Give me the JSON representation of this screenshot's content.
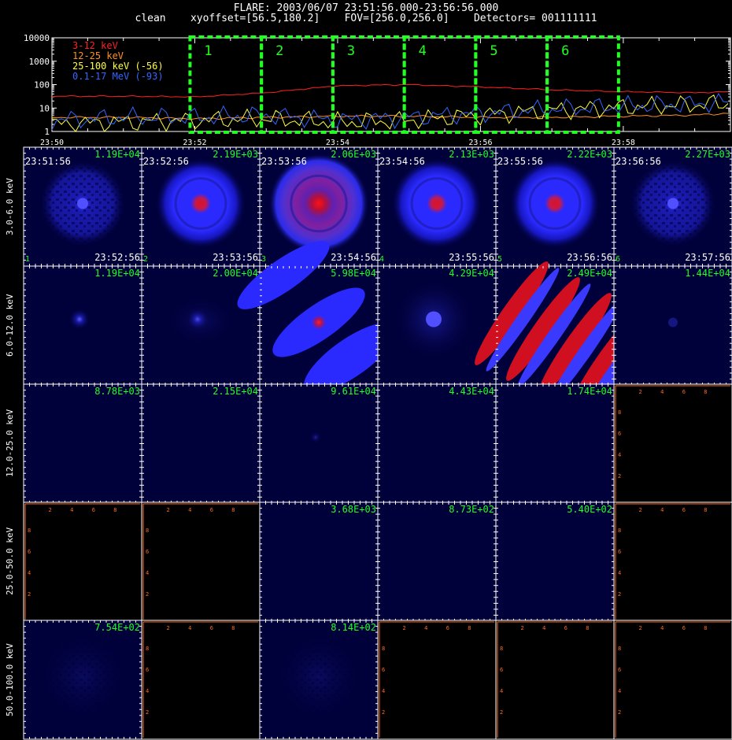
{
  "header": {
    "title": "FLARE: 2003/06/07 23:51:56.000-23:56:56.000",
    "subtitle": "clean    xyoffset=[56.5,180.2]    FOV=[256.0,256.0]    Detectors= 001111111"
  },
  "chart_data": [
    {
      "type": "line",
      "ylog": true,
      "ylim": [
        1,
        10000
      ],
      "ytick_labels": [
        "1",
        "10",
        "100",
        "1000",
        "10000"
      ],
      "xlim": [
        "23:50",
        "23:59:30"
      ],
      "xtick_labels": [
        "23:50",
        "23:52",
        "23:54",
        "23:56",
        "23:58"
      ],
      "grid": false,
      "legend_position": "top-left",
      "series": [
        {
          "name": "3-12 keV",
          "color": "#ff2020",
          "x": [
            "23:50",
            "23:51",
            "23:52",
            "23:53",
            "23:54",
            "23:55",
            "23:56",
            "23:57",
            "23:58",
            "23:59",
            "23:59:30"
          ],
          "values": [
            32,
            32,
            30,
            45,
            90,
            100,
            80,
            60,
            50,
            45,
            50
          ]
        },
        {
          "name": "12-25 keV",
          "color": "#ff9020",
          "x": [
            "23:50",
            "23:51",
            "23:52",
            "23:53",
            "23:54",
            "23:55",
            "23:56",
            "23:57",
            "23:58",
            "23:59",
            "23:59:30"
          ],
          "values": [
            4,
            4,
            3.5,
            4,
            4.5,
            4.5,
            4,
            4,
            4.5,
            5,
            6
          ]
        },
        {
          "name": "25-100 keV (-56)",
          "color": "#ffff40",
          "x": [
            "23:50",
            "23:51",
            "23:52",
            "23:53",
            "23:54",
            "23:55",
            "23:56",
            "23:57",
            "23:58",
            "23:59",
            "23:59:30"
          ],
          "values": [
            2,
            2.5,
            3,
            3.5,
            2.5,
            3,
            5,
            8,
            11,
            14,
            16
          ]
        },
        {
          "name": "0.1-17 MeV (-93)",
          "color": "#3366ff",
          "x": [
            "23:50",
            "23:51",
            "23:52",
            "23:53",
            "23:54",
            "23:55",
            "23:56",
            "23:57",
            "23:58",
            "23:59",
            "23:59:30"
          ],
          "values": [
            3,
            4,
            4,
            5,
            3,
            4,
            6,
            9,
            12,
            15,
            18
          ]
        }
      ],
      "intervals": [
        {
          "label": "1",
          "start": "23:51:56",
          "end": "23:52:56"
        },
        {
          "label": "2",
          "start": "23:52:56",
          "end": "23:53:56"
        },
        {
          "label": "3",
          "start": "23:53:56",
          "end": "23:54:56"
        },
        {
          "label": "4",
          "start": "23:54:56",
          "end": "23:55:56"
        },
        {
          "label": "5",
          "start": "23:55:56",
          "end": "23:56:56"
        },
        {
          "label": "6",
          "start": "23:56:56",
          "end": "23:57:56"
        }
      ]
    },
    {
      "type": "heatmap",
      "row_labels": [
        "3.0-6.0 keV",
        "6.0-12.0 keV",
        "12.0-25.0 keV",
        "25.0-50.0 keV",
        "50.0-100.0 keV"
      ],
      "column_intervals": [
        "1",
        "2",
        "3",
        "4",
        "5",
        "6"
      ],
      "start_times": [
        "23:51:56",
        "23:52:56",
        "23:53:56",
        "23:54:56",
        "23:55:56",
        "23:56:56"
      ],
      "end_times": [
        "23:52:56",
        "23:53:56",
        "23:54:56",
        "23:55:56",
        "23:56:56",
        "23:57:56"
      ],
      "empty_axis_ticks": [
        "2",
        "4",
        "6",
        "8"
      ],
      "peak_values": [
        [
          "1.19E+04",
          "2.19E+03",
          "2.06E+03",
          "2.13E+03",
          "2.22E+03",
          "2.27E+03"
        ],
        [
          "1.19E+04",
          "2.00E+04",
          "5.98E+04",
          "4.29E+04",
          "2.49E+04",
          "1.44E+04"
        ],
        [
          "8.78E+03",
          "2.15E+04",
          "9.61E+04",
          "4.43E+04",
          "1.74E+04",
          ""
        ],
        [
          "",
          "",
          "3.68E+03",
          "8.73E+02",
          "5.40E+02",
          ""
        ],
        [
          "7.54E+02",
          "",
          "8.14E+02",
          "",
          "",
          ""
        ]
      ],
      "image_style": [
        [
          "speckled",
          "ring",
          "ring-strong",
          "ring",
          "ring",
          "speckled"
        ],
        [
          "point",
          "point",
          "streaks",
          "ring-faint",
          "sidelobes",
          "faint"
        ],
        [
          "dark",
          "dark",
          "point-faint",
          "dark",
          "dark",
          "empty"
        ],
        [
          "empty",
          "empty",
          "dark",
          "dark",
          "dark",
          "empty"
        ],
        [
          "speckled-faint",
          "empty",
          "speckled-faint",
          "empty",
          "empty",
          "empty"
        ]
      ]
    }
  ],
  "colors": {
    "background": "#000000",
    "panel_background": "#00003a",
    "peak_label": "#22ff22",
    "interval_box": "#22ff22",
    "empty_axis": "#ff6a22",
    "tick": "#ffffff"
  }
}
